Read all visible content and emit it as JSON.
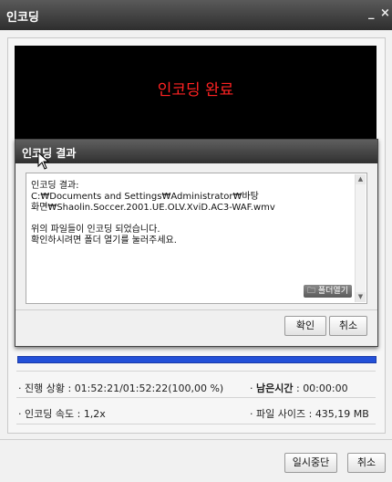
{
  "window": {
    "title": "인코딩",
    "minimize_label": "_",
    "close_label": "×"
  },
  "preview": {
    "status_text": "인코딩 완료"
  },
  "status": {
    "progress_label": "진행 상황",
    "progress_value": "01:52:21/01:52:22(100,00 %)",
    "remaining_label": "남은시간",
    "remaining_value": "00:00:00",
    "speed_label": "인코딩 속도",
    "speed_value": "1,2x",
    "filesize_label": "파일 사이즈",
    "filesize_value": "435,19 MB",
    "progress_percent": 100,
    "bullet": "·"
  },
  "buttons": {
    "pause": "일시중단",
    "cancel": "취소"
  },
  "dialog": {
    "title": "인코딩 결과",
    "lines": [
      "인코딩 결과:",
      "C:₩Documents and Settings₩Administrator₩바탕",
      "화면₩Shaolin.Soccer.2001.UE.OLV.XviD.AC3-WAF.wmv",
      "",
      "위의 파일들이 인코딩 되었습니다.",
      "확인하시려면 폴더 열기를 눌러주세요."
    ],
    "open_folder": "폴더열기",
    "ok": "확인",
    "cancel": "취소"
  },
  "colors": {
    "progress": "#2350d8",
    "done_text": "#ff2222"
  }
}
